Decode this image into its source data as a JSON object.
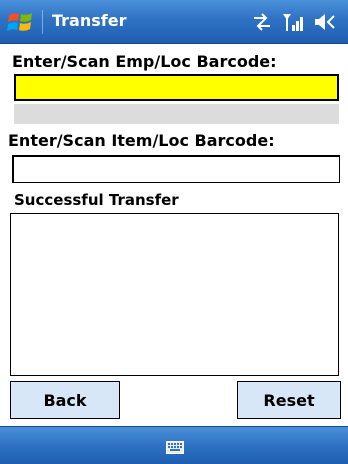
{
  "titlebar": {
    "title": "Transfer",
    "icons": [
      "windows-start-icon",
      "sync-arrows-icon",
      "signal-icon",
      "volume-icon"
    ]
  },
  "form": {
    "emp_label": "Enter/Scan Emp/Loc Barcode:",
    "emp_value": "",
    "item_label": "Enter/Scan Item/Loc Barcode:",
    "item_value": "",
    "success_label": "Successful Transfer"
  },
  "buttons": {
    "back": "Back",
    "reset": "Reset"
  },
  "bottombar": {
    "icons": [
      "keyboard-icon"
    ]
  },
  "colors": {
    "titlebar": "#2f72c4",
    "active_field": "#ffff00",
    "button_bg": "#d7e7f8",
    "status_bar": "#dcdcdc"
  }
}
